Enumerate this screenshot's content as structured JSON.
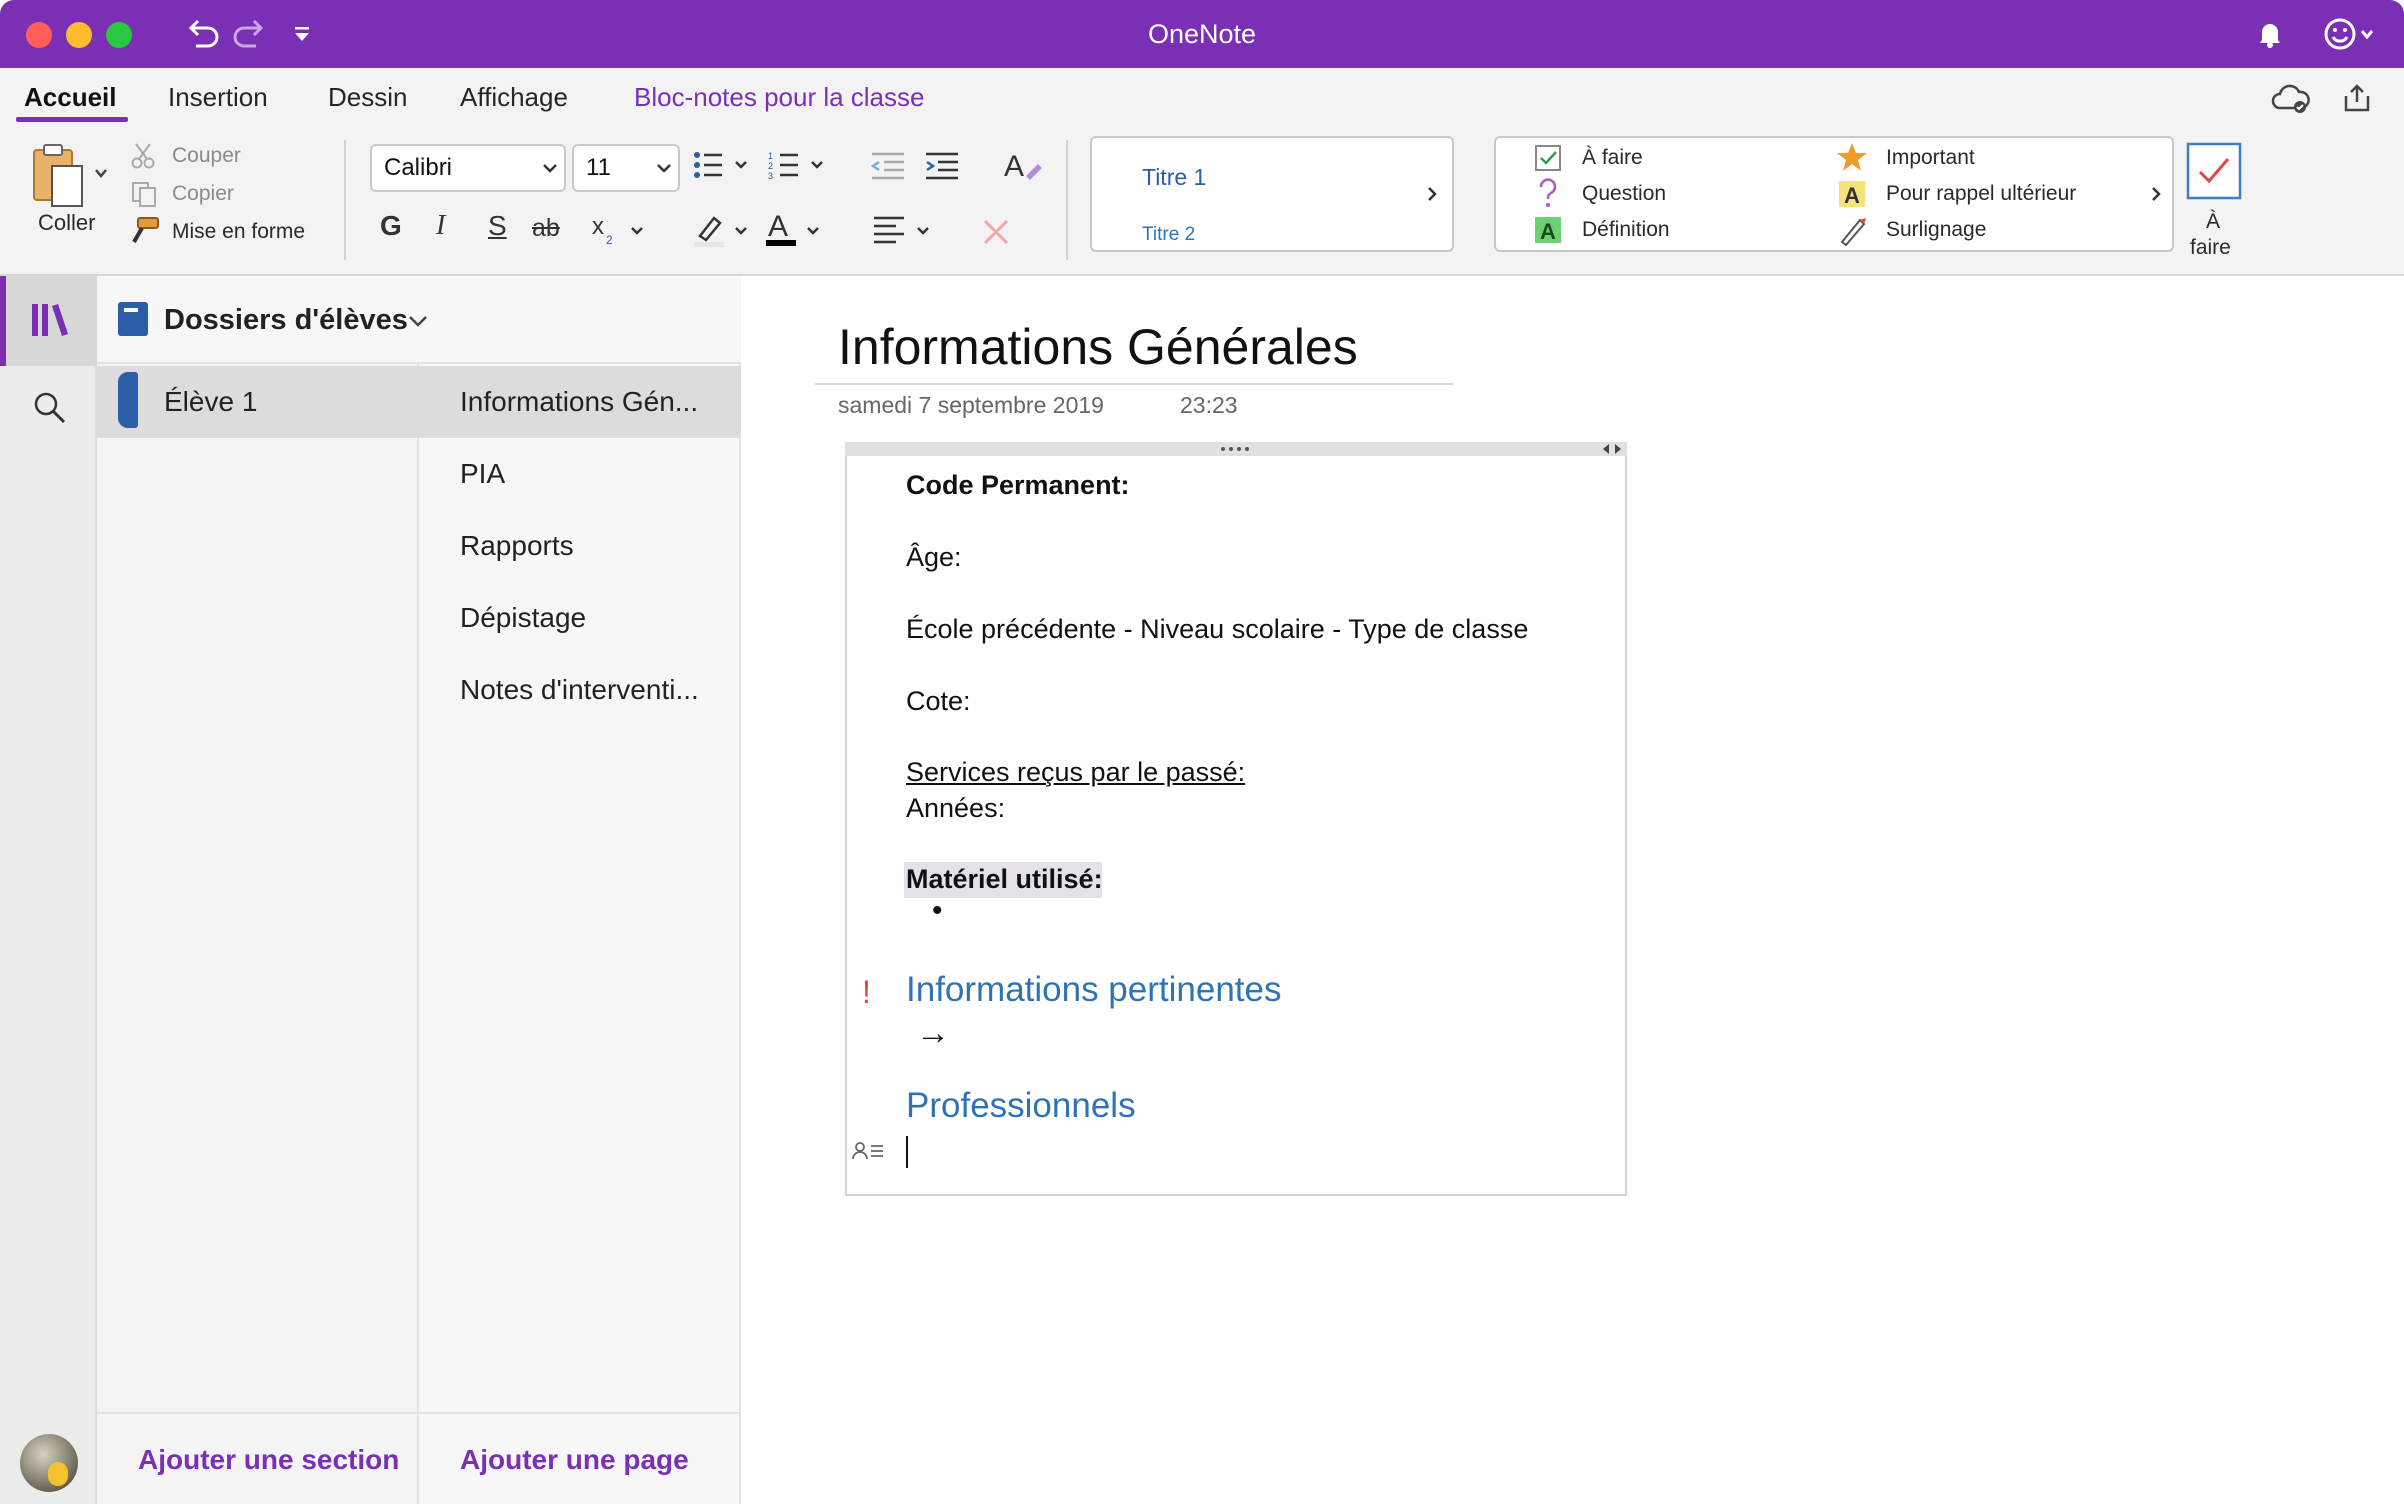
{
  "window": {
    "title": "OneNote"
  },
  "tabs": [
    {
      "label": "Accueil",
      "active": true
    },
    {
      "label": "Insertion"
    },
    {
      "label": "Dessin"
    },
    {
      "label": "Affichage"
    },
    {
      "label": "Bloc-notes pour la classe",
      "accent": true
    }
  ],
  "ribbon": {
    "paste_label": "Coller",
    "cut_label": "Couper",
    "copy_label": "Copier",
    "format_painter_label": "Mise en forme",
    "font_name": "Calibri",
    "font_size": "11",
    "bold_glyph": "G",
    "italic_glyph": "I",
    "underline_glyph": "S",
    "strike_glyph": "ab",
    "styles": {
      "title1": "Titre 1",
      "title2": "Titre 2"
    },
    "tags": [
      {
        "label": "À faire",
        "icon": "checkbox-icon"
      },
      {
        "label": "Question",
        "icon": "question-icon"
      },
      {
        "label": "Définition",
        "icon": "definition-icon"
      },
      {
        "label": "Important",
        "icon": "star-icon"
      },
      {
        "label": "Pour rappel ultérieur",
        "icon": "reminder-icon"
      },
      {
        "label": "Surlignage",
        "icon": "highlighter-icon"
      }
    ],
    "todo_tag_label_line1": "À",
    "todo_tag_label_line2": "faire"
  },
  "navigation": {
    "notebook_name": "Dossiers d'élèves",
    "sections": [
      {
        "label": "Élève 1",
        "selected": true,
        "color": "#2b5ea7"
      }
    ],
    "pages": [
      {
        "label": "Informations Gén...",
        "selected": true
      },
      {
        "label": "PIA"
      },
      {
        "label": "Rapports"
      },
      {
        "label": "Dépistage"
      },
      {
        "label": "Notes d'interventi..."
      }
    ],
    "add_section_label": "Ajouter une section",
    "add_page_label": "Ajouter une page"
  },
  "page": {
    "title": "Informations Générales",
    "date": "samedi 7 septembre 2019",
    "time": "23:23",
    "lines": {
      "code_permanent": "Code Permanent:",
      "age": "Âge:",
      "ecole": "École précédente - Niveau scolaire - Type de classe",
      "cote": "Cote:",
      "services": "Services reçus par le passé:",
      "annees": "Années:",
      "materiel": "Matériel utilisé:",
      "bullet": "•",
      "heading1": "Informations pertinentes",
      "arrow": "→",
      "heading2": "Professionnels",
      "important_mark": "!"
    }
  },
  "colors": {
    "accent": "#7b2fb5",
    "heading_blue": "#2e74b5"
  }
}
